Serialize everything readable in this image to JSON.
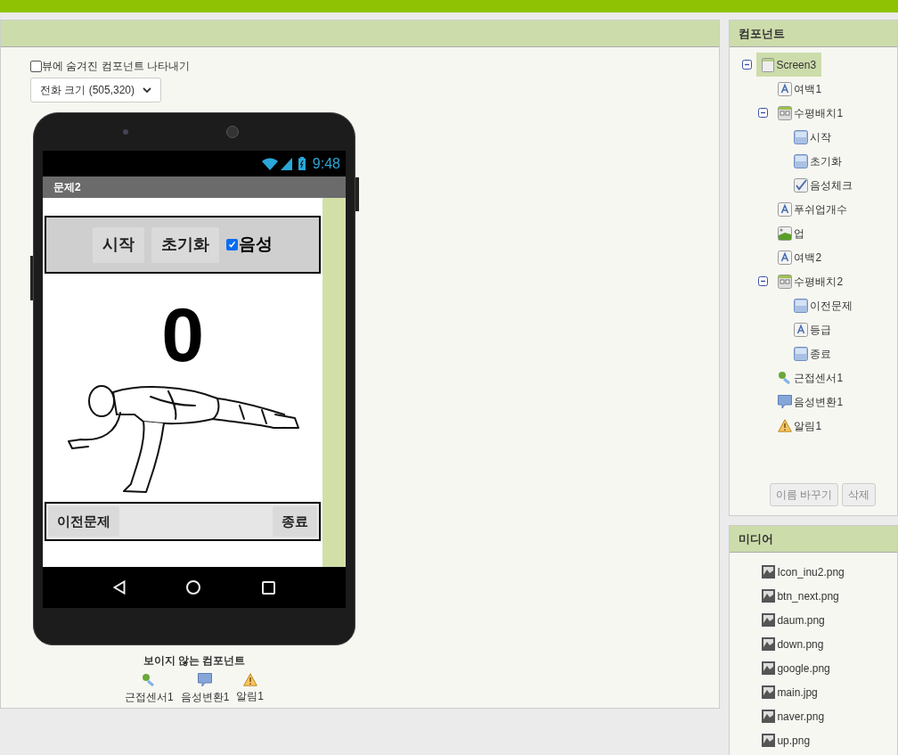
{
  "viewer": {
    "show_hidden": {
      "label": "뷰에 숨겨진 컴포넌트 나타내기",
      "checked": false
    },
    "phone_size": "전화 크기 (505,320)",
    "phone": {
      "time": "9:48",
      "title": "문제2",
      "top_row": [
        {
          "kind": "button",
          "label": "시작"
        },
        {
          "kind": "button",
          "label": "초기화"
        },
        {
          "kind": "checkbox",
          "label": "음성",
          "checked": true
        }
      ],
      "count": "0",
      "bottom_row": [
        {
          "kind": "button",
          "label": "이전문제"
        },
        {
          "kind": "button",
          "label": "종료"
        }
      ]
    },
    "nonvisible": {
      "title": "보이지 않는 컴포넌트",
      "items": [
        {
          "kind": "sensor",
          "label": "근접센서1"
        },
        {
          "kind": "speech",
          "label": "음성변환1"
        },
        {
          "kind": "notifier",
          "label": "알림1"
        }
      ]
    }
  },
  "components": {
    "title": "컴포넌트",
    "tree": [
      {
        "kind": "screen",
        "label": "Screen3",
        "selected": true,
        "expanded": true,
        "children": [
          {
            "kind": "label",
            "label": "여백1",
            "selected": false
          },
          {
            "kind": "arrangement",
            "label": "수평배치1",
            "selected": false,
            "expanded": true,
            "children": [
              {
                "kind": "button",
                "label": "시작",
                "selected": false
              },
              {
                "kind": "button",
                "label": "초기화",
                "selected": false
              },
              {
                "kind": "checkbox",
                "label": "음성체크",
                "selected": false
              }
            ]
          },
          {
            "kind": "label",
            "label": "푸쉬업개수",
            "selected": false
          },
          {
            "kind": "image",
            "label": "업",
            "selected": false
          },
          {
            "kind": "label",
            "label": "여백2",
            "selected": false
          },
          {
            "kind": "arrangement",
            "label": "수평배치2",
            "selected": false,
            "expanded": true,
            "children": [
              {
                "kind": "button",
                "label": "이전문제",
                "selected": false
              },
              {
                "kind": "label",
                "label": "등급",
                "selected": false
              },
              {
                "kind": "button",
                "label": "종료",
                "selected": false
              }
            ]
          },
          {
            "kind": "sensor",
            "label": "근접센서1",
            "selected": false
          },
          {
            "kind": "speech",
            "label": "음성변환1",
            "selected": false
          },
          {
            "kind": "notifier",
            "label": "알림1",
            "selected": false
          }
        ]
      }
    ],
    "buttons": [
      "이름 바꾸기",
      "삭제"
    ]
  },
  "media": {
    "title": "미디어",
    "files": [
      "Icon_inu2.png",
      "btn_next.png",
      "daum.png",
      "down.png",
      "google.png",
      "main.jpg",
      "naver.png",
      "up.png"
    ]
  }
}
